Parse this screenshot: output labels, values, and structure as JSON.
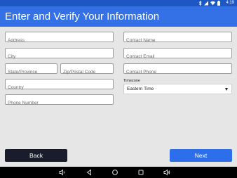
{
  "status_bar": {
    "time": "4:19",
    "icons": [
      "bluetooth-icon",
      "signal-icon",
      "wifi-icon",
      "battery-icon"
    ],
    "color": "#1c57c4"
  },
  "header": {
    "title": "Enter and Verify Your Information",
    "color": "#3470e6"
  },
  "form": {
    "address": {
      "placeholder": "Address",
      "value": ""
    },
    "city": {
      "placeholder": "City",
      "value": ""
    },
    "state": {
      "placeholder": "State/Province",
      "value": ""
    },
    "zip": {
      "placeholder": "Zip/Postal Code",
      "value": ""
    },
    "country": {
      "placeholder": "Country",
      "value": ""
    },
    "phone": {
      "placeholder": "Phone Number",
      "value": ""
    },
    "contact_name": {
      "placeholder": "Contact Name",
      "value": ""
    },
    "contact_email": {
      "placeholder": "Contact Email",
      "value": ""
    },
    "contact_phone": {
      "placeholder": "Contact Phone",
      "value": ""
    },
    "timezone": {
      "label": "Timezone",
      "selected": "Eastern Time"
    }
  },
  "actions": {
    "back_label": "Back",
    "next_label": "Next",
    "back_color": "#1a1c2b",
    "next_color": "#2d6fea"
  },
  "nav_bar": {
    "icons": [
      "volume-down-icon",
      "back-icon",
      "home-icon",
      "recents-icon",
      "volume-up-icon"
    ]
  }
}
